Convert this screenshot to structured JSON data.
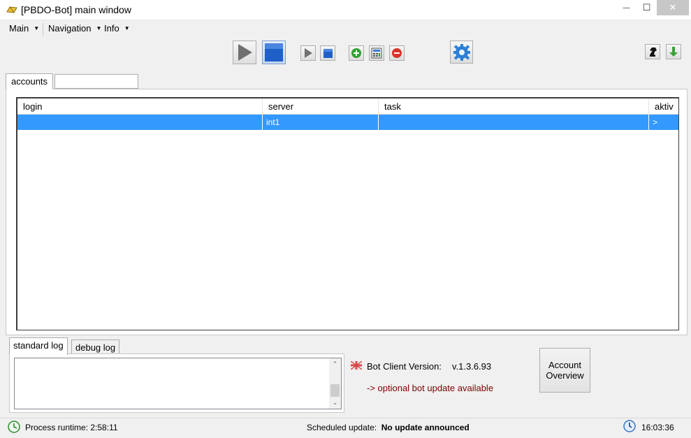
{
  "window": {
    "title": "[PBDO-Bot] main window",
    "minimize_glyph": "—",
    "maximize_glyph": "☐",
    "close_glyph": "✕"
  },
  "menu": {
    "items": [
      {
        "label": "Main"
      },
      {
        "label": "Navigation"
      },
      {
        "label": "Info"
      }
    ],
    "arrow_glyph": "▼"
  },
  "toolbar": {
    "icons": [
      "play-large-icon",
      "stop-large-icon",
      "play-small-icon",
      "stop-small-icon",
      "add-icon",
      "calculator-icon",
      "remove-icon",
      "settings-gear-icon",
      "chess-knight-icon",
      "download-arrow-icon"
    ],
    "colors": {
      "play": "#6e6e6e",
      "stop": "#1f5fc8",
      "add": "#2fa02f",
      "remove": "#d9342b",
      "gear": "#2d7fd6",
      "download": "#3aa23a"
    }
  },
  "accounts_tabs": {
    "tabs": [
      {
        "label": "accounts"
      }
    ],
    "filter_value": ""
  },
  "accounts_table": {
    "columns": [
      "login",
      "server",
      "task",
      "aktiv"
    ],
    "rows": [
      {
        "login": "",
        "server": "int1",
        "task": "",
        "aktiv": ">"
      }
    ],
    "selection_color": "#3399ff"
  },
  "log": {
    "tabs": [
      {
        "label": "standard log"
      },
      {
        "label": "debug log"
      }
    ],
    "content": "",
    "scroll_up": "⌃",
    "scroll_down": "⌄"
  },
  "version": {
    "label": "Bot Client Version:",
    "value": "v.1.3.6.93",
    "update_note": "-> optional bot update available",
    "note_color": "#800000"
  },
  "account_overview_button": {
    "label": "Account Overview"
  },
  "statusbar": {
    "runtime_label": "Process runtime:",
    "runtime_value": "2:58:11",
    "scheduled_label": "Scheduled update:",
    "scheduled_value": "No update announced",
    "clock": "16:03:36"
  }
}
